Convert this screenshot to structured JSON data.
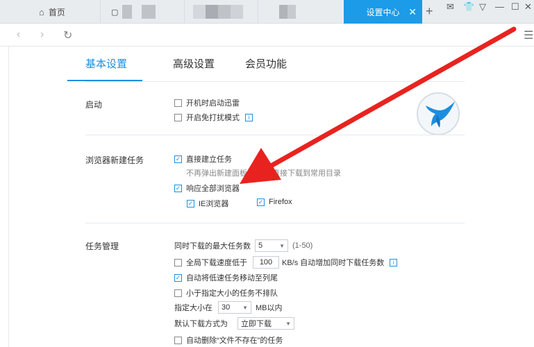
{
  "tabbar": {
    "home_icon": "home-icon",
    "home_label": "首页",
    "active_tab_label": "设置中心",
    "new_tab": "+"
  },
  "settings_tabs": [
    "基本设置",
    "高级设置",
    "会员功能"
  ],
  "startup": {
    "label": "启动",
    "options": [
      {
        "label": "开机时启动迅雷",
        "checked": false
      },
      {
        "label": "开启免打扰模式",
        "checked": false
      }
    ]
  },
  "browser_tasks": {
    "label": "浏览器新建任务",
    "direct": {
      "label": "直接建立任务",
      "checked": true
    },
    "hint_left": "不再弹出新建面板",
    "hint_right": "件直接下载到常用目录",
    "respond_all": {
      "label": "响应全部浏览器",
      "checked": true
    },
    "ie": {
      "label": "IE浏览器",
      "checked": true
    },
    "firefox": {
      "label": "Firefox",
      "checked": true
    }
  },
  "task_mgmt": {
    "label": "任务管理",
    "max_tasks_label": "同时下载的最大任务数",
    "max_tasks_value": "5",
    "max_tasks_range": "(1-50)",
    "speed_label": "全局下载速度低于",
    "speed_value": "100",
    "speed_suffix": "KB/s 自动增加同时下载任务数",
    "auto_move_label": "自动将低速任务移动至列尾",
    "small_label": "小于指定大小的任务不排队",
    "size_label": "指定大小在",
    "size_value": "30",
    "size_suffix": "MB以内",
    "default_mode_label": "默认下载方式为",
    "default_mode_value": "立即下载",
    "auto_delete_label": "自动删除“文件不存在”的任务"
  },
  "colors": {
    "accent": "#1c9be8",
    "arrow": "#e8231f"
  }
}
